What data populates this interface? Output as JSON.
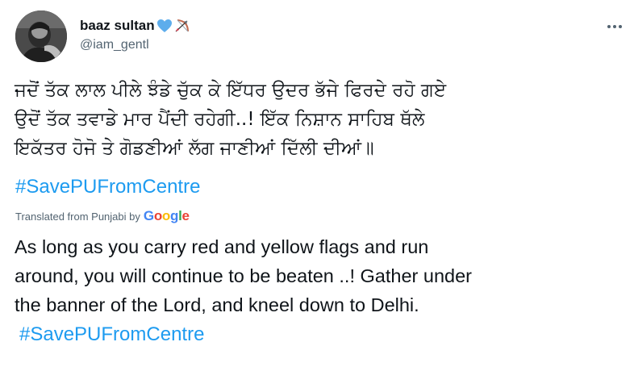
{
  "author": {
    "display_name": "baaz sultan",
    "handle": "@iam_gentl",
    "name_emojis": [
      "blue-heart-icon",
      "bow-and-arrow-icon"
    ]
  },
  "tweet": {
    "original_lines": [
      "ਜਦੋਂ ਤੱਕ ਲਾਲ ਪੀਲੇ ਝੰਡੇ ਚੁੱਕ ਕੇ ਇੱਧਰ ਉਦਰ ਭੱਜੇ ਫਿਰਦੇ ਰਹੋ ਗਏ",
      "ਉਦੋਂ ਤੱਕ ਤਵਾਡੇ ਮਾਰ ਪੈਂਦੀ ਰਹੇਗੀ..! ਇੱਕ ਨਿਸ਼ਾਨ ਸਾਹਿਬ ਥੱਲੇ",
      "ਇਕੱਤਰ ਹੋਜੋ ਤੇ ਗੋਡਣੀਆਂ ਲੱਗ ਜਾਣੀਆਂ ਦਿੱਲੀ ਦੀਆਂ॥"
    ],
    "original_hashtag": "#SavePUFromCentre",
    "translated_from": "Translated from Punjabi by",
    "google_logo_letters": [
      "G",
      "o",
      "o",
      "g",
      "l",
      "e"
    ],
    "translation_lines": [
      "As long as you carry red and yellow flags and run",
      "around, you will continue to be beaten ..! Gather under",
      "the banner of the Lord, and kneel down to Delhi."
    ],
    "translation_hashtag": "#SavePUFromCentre"
  },
  "colors": {
    "link": "#1d9bf0",
    "secondary_text": "#536471",
    "google": [
      "#4285F4",
      "#EA4335",
      "#FBBC05",
      "#4285F4",
      "#34A853",
      "#EA4335"
    ]
  }
}
